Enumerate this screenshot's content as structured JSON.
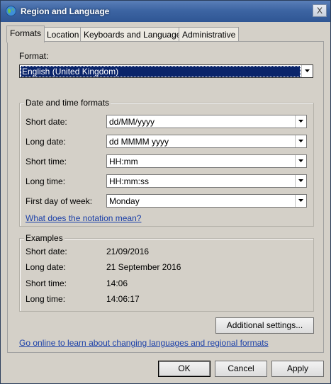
{
  "window": {
    "title": "Region and Language",
    "close_label": "X"
  },
  "tabs": [
    {
      "label": "Formats",
      "active": true
    },
    {
      "label": "Location",
      "active": false
    },
    {
      "label": "Keyboards and Languages",
      "active": false
    },
    {
      "label": "Administrative",
      "active": false
    }
  ],
  "format": {
    "label": "Format:",
    "value": "English (United Kingdom)"
  },
  "date_time_formats": {
    "group_label": "Date and time formats",
    "fields": [
      {
        "label": "Short date:",
        "value": "dd/MM/yyyy"
      },
      {
        "label": "Long date:",
        "value": "dd MMMM yyyy"
      },
      {
        "label": "Short time:",
        "value": "HH:mm"
      },
      {
        "label": "Long time:",
        "value": "HH:mm:ss"
      },
      {
        "label": "First day of week:",
        "value": "Monday"
      }
    ],
    "notation_link": "What does the notation mean?"
  },
  "examples": {
    "group_label": "Examples",
    "rows": [
      {
        "label": "Short date:",
        "value": "21/09/2016"
      },
      {
        "label": "Long date:",
        "value": "21 September 2016"
      },
      {
        "label": "Short time:",
        "value": "14:06"
      },
      {
        "label": "Long time:",
        "value": "14:06:17"
      }
    ]
  },
  "additional_settings_label": "Additional settings...",
  "online_link": "Go online to learn about changing languages and regional formats",
  "footer": {
    "ok_label": "OK",
    "cancel_label": "Cancel",
    "apply_label": "Apply"
  },
  "colors": {
    "selection": "#0a246a",
    "link": "#1a3fa8",
    "dialog_face": "#d4d0c8"
  },
  "icons": {
    "app": "globe-icon",
    "dropdown": "chevron-down-icon"
  }
}
